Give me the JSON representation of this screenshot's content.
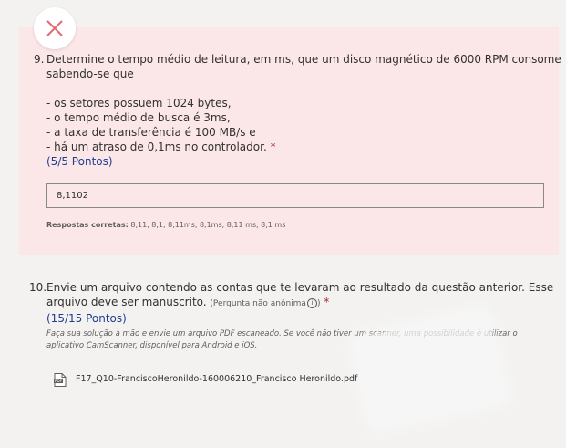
{
  "question9": {
    "number": "9.",
    "lines": [
      "Determine o tempo médio de leitura, em ms, que um disco magnético de 6000 RPM consome",
      "sabendo-se que",
      "",
      "- os setores possuem 1024 bytes,",
      "- o tempo médio de busca é 3ms,",
      "- a taxa de transferência é 100 MB/s e",
      "- há um atraso de 0,1ms no controlador."
    ],
    "required_mark": "*",
    "points": "(5/5 Pontos)",
    "answer_value": "8,1102",
    "correct_label": "Respostas corretas:",
    "correct_values": "8,11, 8,1, 8,11ms, 8,1ms, 8,11 ms, 8,1 ms",
    "status_icon": "close-icon",
    "status_color": "#e06b74",
    "panel_color": "#fbe6e8"
  },
  "question10": {
    "number": "10.",
    "line1": "Envie um arquivo contendo as contas que te levaram ao resultado da questão anterior. Esse",
    "line2": "arquivo deve ser manuscrito.",
    "anon_label": "(Pergunta não anônima",
    "anon_close": ")",
    "info_icon": "i",
    "required_mark": "*",
    "points": "(15/15 Pontos)",
    "hint_line1": "Faça sua solução à mão e envie um arquivo PDF escaneado. Se você não tiver um scanner, uma possibilidade é utilizar o",
    "hint_line2": "aplicativo CamScanner, disponível para Android e iOS.",
    "file_name": "F17_Q10-FranciscoHeronildo-160006210_Francisco Heronildo.pdf",
    "file_icon": "pdf-file-icon"
  },
  "colors": {
    "points_blue": "#1f3f8e",
    "required_red": "#a4262c",
    "page_bg": "#f3f2f1"
  }
}
